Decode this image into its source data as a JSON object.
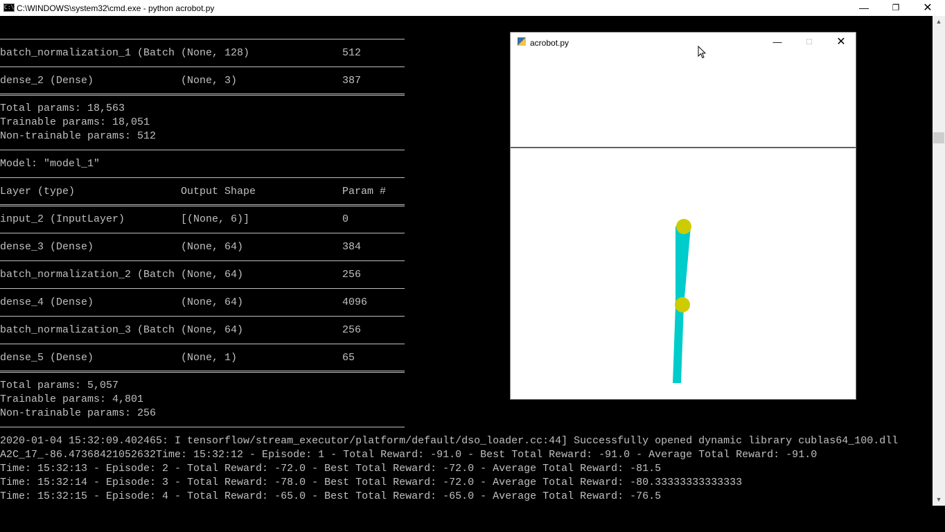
{
  "window": {
    "title": "C:\\WINDOWS\\system32\\cmd.exe - python  acrobot.py",
    "icon_text": "C:\\",
    "minimize_glyph": "—",
    "maximize_glyph": "❐",
    "close_glyph": "✕"
  },
  "console": {
    "lines": [
      {
        "kind": "rule"
      },
      {
        "kind": "row",
        "cols": [
          "batch_normalization_1 (Batch",
          "(None, 128)",
          "512"
        ]
      },
      {
        "kind": "rule"
      },
      {
        "kind": "row",
        "cols": [
          "dense_2 (Dense)",
          "(None, 3)",
          "387"
        ]
      },
      {
        "kind": "double"
      },
      {
        "kind": "text",
        "text": "Total params: 18,563"
      },
      {
        "kind": "text",
        "text": "Trainable params: 18,051"
      },
      {
        "kind": "text",
        "text": "Non-trainable params: 512"
      },
      {
        "kind": "rule"
      },
      {
        "kind": "text",
        "text": "Model: \"model_1\""
      },
      {
        "kind": "rule"
      },
      {
        "kind": "row",
        "cols": [
          "Layer (type)",
          "Output Shape",
          "Param #"
        ]
      },
      {
        "kind": "double"
      },
      {
        "kind": "row",
        "cols": [
          "input_2 (InputLayer)",
          "[(None, 6)]",
          "0"
        ]
      },
      {
        "kind": "rule"
      },
      {
        "kind": "row",
        "cols": [
          "dense_3 (Dense)",
          "(None, 64)",
          "384"
        ]
      },
      {
        "kind": "rule"
      },
      {
        "kind": "row",
        "cols": [
          "batch_normalization_2 (Batch",
          "(None, 64)",
          "256"
        ]
      },
      {
        "kind": "rule"
      },
      {
        "kind": "row",
        "cols": [
          "dense_4 (Dense)",
          "(None, 64)",
          "4096"
        ]
      },
      {
        "kind": "rule"
      },
      {
        "kind": "row",
        "cols": [
          "batch_normalization_3 (Batch",
          "(None, 64)",
          "256"
        ]
      },
      {
        "kind": "rule"
      },
      {
        "kind": "row",
        "cols": [
          "dense_5 (Dense)",
          "(None, 1)",
          "65"
        ]
      },
      {
        "kind": "double"
      },
      {
        "kind": "text",
        "text": "Total params: 5,057"
      },
      {
        "kind": "text",
        "text": "Trainable params: 4,801"
      },
      {
        "kind": "text",
        "text": "Non-trainable params: 256"
      },
      {
        "kind": "rule"
      },
      {
        "kind": "text",
        "text": "2020-01-04 15:32:09.402465: I tensorflow/stream_executor/platform/default/dso_loader.cc:44] Successfully opened dynamic library cublas64_100.dll"
      },
      {
        "kind": "text",
        "text": "A2C_17_-86.47368421052632Time: 15:32:12 - Episode: 1 - Total Reward: -91.0 - Best Total Reward: -91.0 - Average Total Reward: -91.0"
      },
      {
        "kind": "text",
        "text": "Time: 15:32:13 - Episode: 2 - Total Reward: -72.0 - Best Total Reward: -72.0 - Average Total Reward: -81.5"
      },
      {
        "kind": "text",
        "text": "Time: 15:32:14 - Episode: 3 - Total Reward: -78.0 - Best Total Reward: -72.0 - Average Total Reward: -80.33333333333333"
      },
      {
        "kind": "text",
        "text": "Time: 15:32:15 - Episode: 4 - Total Reward: -65.0 - Best Total Reward: -65.0 - Average Total Reward: -76.5"
      }
    ]
  },
  "scrollbar": {
    "up_glyph": "▲",
    "down_glyph": "▼"
  },
  "acrobot": {
    "title": "acrobot.py",
    "minimize_glyph": "—",
    "maximize_glyph": "☐",
    "close_glyph": "✕",
    "colors": {
      "link": "#00cccc",
      "joint": "#cccc00",
      "ground_line": "#000000",
      "background": "#ffffff"
    }
  }
}
